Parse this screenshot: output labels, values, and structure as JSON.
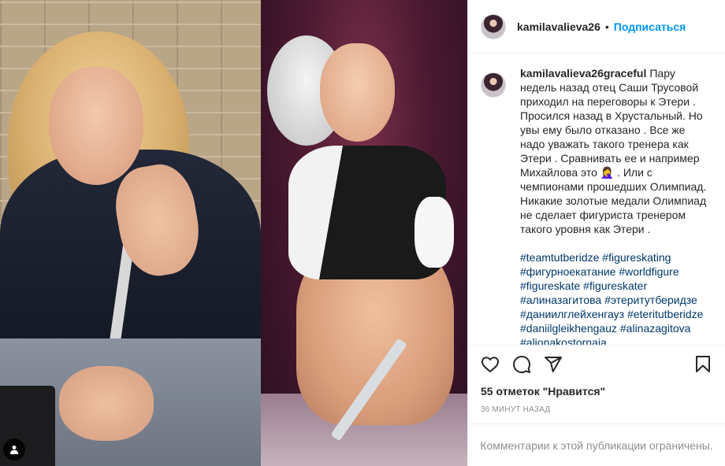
{
  "post": {
    "username": "kamilavalieva26",
    "separator": "•",
    "follow_label": "Подписаться",
    "caption": {
      "author": "kamilavalieva26graceful",
      "text": "Пару недель назад отец Саши Трусовой приходил на переговоры к Этери . Просился назад в Хрустальный. Но увы ему было отказано . Все же надо уважать такого тренера как Этери . Сравнивать ее и например Михайлова это 🤦‍♀️ . Или с чемпионами прошедших Олимпиад. Никакие золотые медали Олимпиад не сделает фигуриста тренером такого уровня как Этери .",
      "hashtags": [
        "#teamtutberidze",
        "#figureskating",
        "#фигурноекатание",
        "#worldfigure",
        "#figureskate",
        "#figureskater",
        "#алиназагитова",
        "#этеритутберидзе",
        "#даниилглейхенгауз",
        "#eteritutberidze",
        "#daniilgleikhengauz",
        "#alinazagitova",
        "#alionakostornaia"
      ]
    },
    "likes_label": "55 отметок \"Нравится\"",
    "timestamp": "36 МИНУТ НАЗАД",
    "comments_disabled": "Комментарии к этой публикации ограничены."
  },
  "icons": {
    "like": "heart-icon",
    "comment": "comment-icon",
    "share": "share-icon",
    "save": "bookmark-icon",
    "tag": "user-tag-icon"
  },
  "colors": {
    "accent": "#0095f6",
    "hashtag": "#00376b",
    "muted": "#8e8e8e",
    "border": "#efefef"
  }
}
